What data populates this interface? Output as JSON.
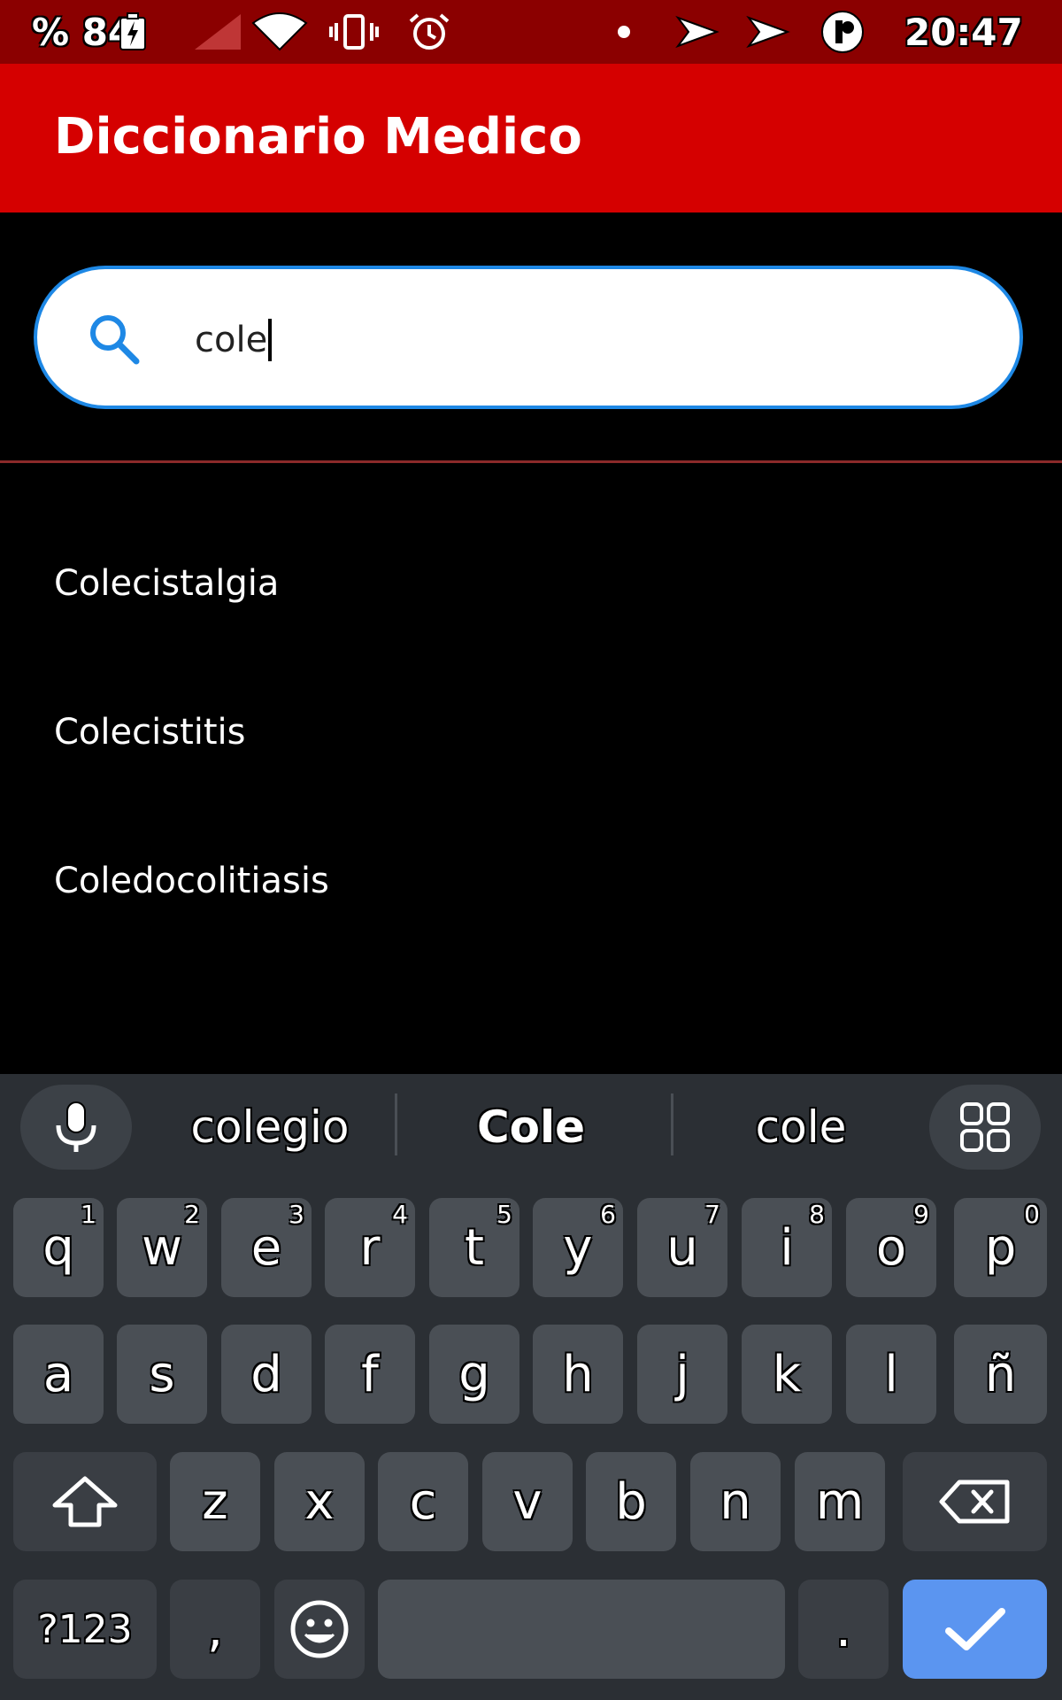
{
  "status_bar": {
    "battery_percent": "% 84",
    "time": "20:47"
  },
  "app_bar": {
    "title": "Diccionario Medico"
  },
  "search": {
    "value": "cole"
  },
  "results": [
    {
      "label": "Colecistalgia"
    },
    {
      "label": "Colecistitis"
    },
    {
      "label": "Coledocolitiasis"
    }
  ],
  "keyboard": {
    "suggestions": [
      "colegio",
      "Cole",
      "cole"
    ],
    "row1": [
      {
        "label": "q",
        "hint": "1"
      },
      {
        "label": "w",
        "hint": "2"
      },
      {
        "label": "e",
        "hint": "3"
      },
      {
        "label": "r",
        "hint": "4"
      },
      {
        "label": "t",
        "hint": "5"
      },
      {
        "label": "y",
        "hint": "6"
      },
      {
        "label": "u",
        "hint": "7"
      },
      {
        "label": "i",
        "hint": "8"
      },
      {
        "label": "o",
        "hint": "9"
      },
      {
        "label": "p",
        "hint": "0"
      }
    ],
    "row2": [
      "a",
      "s",
      "d",
      "f",
      "g",
      "h",
      "j",
      "k",
      "l",
      "ñ"
    ],
    "row3": [
      "z",
      "x",
      "c",
      "v",
      "b",
      "n",
      "m"
    ],
    "symbols_label": "?123",
    "comma_label": ",",
    "period_label": "."
  },
  "colors": {
    "status_bar": "#8b0000",
    "app_bar": "#d50000",
    "search_border": "#1e88e5",
    "keyboard_bg": "#2b2f34",
    "key_bg": "#4a4f55",
    "action_key": "#5b95f0"
  }
}
